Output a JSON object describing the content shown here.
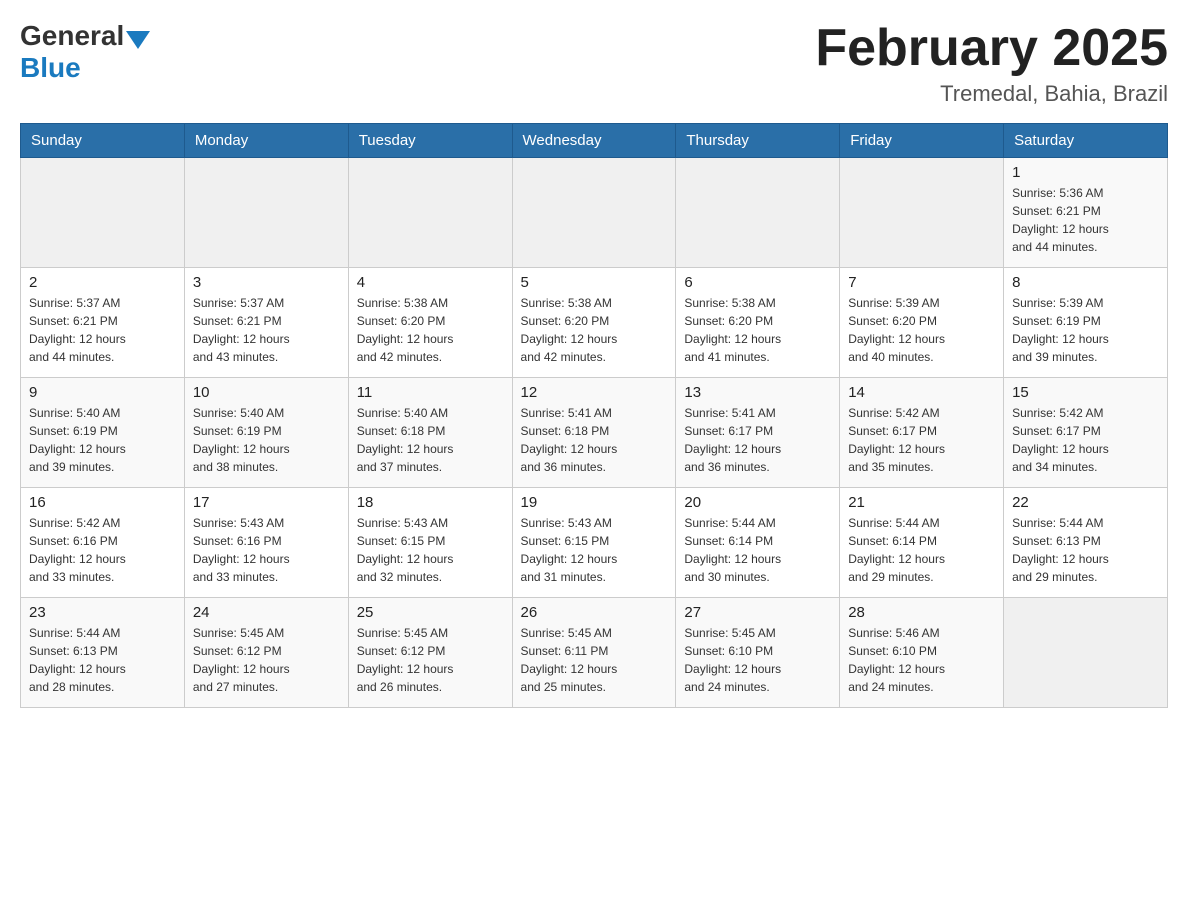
{
  "header": {
    "logo_general": "General",
    "logo_blue": "Blue",
    "month_title": "February 2025",
    "location": "Tremedal, Bahia, Brazil"
  },
  "weekdays": [
    "Sunday",
    "Monday",
    "Tuesday",
    "Wednesday",
    "Thursday",
    "Friday",
    "Saturday"
  ],
  "weeks": [
    [
      {
        "day": "",
        "info": ""
      },
      {
        "day": "",
        "info": ""
      },
      {
        "day": "",
        "info": ""
      },
      {
        "day": "",
        "info": ""
      },
      {
        "day": "",
        "info": ""
      },
      {
        "day": "",
        "info": ""
      },
      {
        "day": "1",
        "info": "Sunrise: 5:36 AM\nSunset: 6:21 PM\nDaylight: 12 hours\nand 44 minutes."
      }
    ],
    [
      {
        "day": "2",
        "info": "Sunrise: 5:37 AM\nSunset: 6:21 PM\nDaylight: 12 hours\nand 44 minutes."
      },
      {
        "day": "3",
        "info": "Sunrise: 5:37 AM\nSunset: 6:21 PM\nDaylight: 12 hours\nand 43 minutes."
      },
      {
        "day": "4",
        "info": "Sunrise: 5:38 AM\nSunset: 6:20 PM\nDaylight: 12 hours\nand 42 minutes."
      },
      {
        "day": "5",
        "info": "Sunrise: 5:38 AM\nSunset: 6:20 PM\nDaylight: 12 hours\nand 42 minutes."
      },
      {
        "day": "6",
        "info": "Sunrise: 5:38 AM\nSunset: 6:20 PM\nDaylight: 12 hours\nand 41 minutes."
      },
      {
        "day": "7",
        "info": "Sunrise: 5:39 AM\nSunset: 6:20 PM\nDaylight: 12 hours\nand 40 minutes."
      },
      {
        "day": "8",
        "info": "Sunrise: 5:39 AM\nSunset: 6:19 PM\nDaylight: 12 hours\nand 39 minutes."
      }
    ],
    [
      {
        "day": "9",
        "info": "Sunrise: 5:40 AM\nSunset: 6:19 PM\nDaylight: 12 hours\nand 39 minutes."
      },
      {
        "day": "10",
        "info": "Sunrise: 5:40 AM\nSunset: 6:19 PM\nDaylight: 12 hours\nand 38 minutes."
      },
      {
        "day": "11",
        "info": "Sunrise: 5:40 AM\nSunset: 6:18 PM\nDaylight: 12 hours\nand 37 minutes."
      },
      {
        "day": "12",
        "info": "Sunrise: 5:41 AM\nSunset: 6:18 PM\nDaylight: 12 hours\nand 36 minutes."
      },
      {
        "day": "13",
        "info": "Sunrise: 5:41 AM\nSunset: 6:17 PM\nDaylight: 12 hours\nand 36 minutes."
      },
      {
        "day": "14",
        "info": "Sunrise: 5:42 AM\nSunset: 6:17 PM\nDaylight: 12 hours\nand 35 minutes."
      },
      {
        "day": "15",
        "info": "Sunrise: 5:42 AM\nSunset: 6:17 PM\nDaylight: 12 hours\nand 34 minutes."
      }
    ],
    [
      {
        "day": "16",
        "info": "Sunrise: 5:42 AM\nSunset: 6:16 PM\nDaylight: 12 hours\nand 33 minutes."
      },
      {
        "day": "17",
        "info": "Sunrise: 5:43 AM\nSunset: 6:16 PM\nDaylight: 12 hours\nand 33 minutes."
      },
      {
        "day": "18",
        "info": "Sunrise: 5:43 AM\nSunset: 6:15 PM\nDaylight: 12 hours\nand 32 minutes."
      },
      {
        "day": "19",
        "info": "Sunrise: 5:43 AM\nSunset: 6:15 PM\nDaylight: 12 hours\nand 31 minutes."
      },
      {
        "day": "20",
        "info": "Sunrise: 5:44 AM\nSunset: 6:14 PM\nDaylight: 12 hours\nand 30 minutes."
      },
      {
        "day": "21",
        "info": "Sunrise: 5:44 AM\nSunset: 6:14 PM\nDaylight: 12 hours\nand 29 minutes."
      },
      {
        "day": "22",
        "info": "Sunrise: 5:44 AM\nSunset: 6:13 PM\nDaylight: 12 hours\nand 29 minutes."
      }
    ],
    [
      {
        "day": "23",
        "info": "Sunrise: 5:44 AM\nSunset: 6:13 PM\nDaylight: 12 hours\nand 28 minutes."
      },
      {
        "day": "24",
        "info": "Sunrise: 5:45 AM\nSunset: 6:12 PM\nDaylight: 12 hours\nand 27 minutes."
      },
      {
        "day": "25",
        "info": "Sunrise: 5:45 AM\nSunset: 6:12 PM\nDaylight: 12 hours\nand 26 minutes."
      },
      {
        "day": "26",
        "info": "Sunrise: 5:45 AM\nSunset: 6:11 PM\nDaylight: 12 hours\nand 25 minutes."
      },
      {
        "day": "27",
        "info": "Sunrise: 5:45 AM\nSunset: 6:10 PM\nDaylight: 12 hours\nand 24 minutes."
      },
      {
        "day": "28",
        "info": "Sunrise: 5:46 AM\nSunset: 6:10 PM\nDaylight: 12 hours\nand 24 minutes."
      },
      {
        "day": "",
        "info": ""
      }
    ]
  ]
}
